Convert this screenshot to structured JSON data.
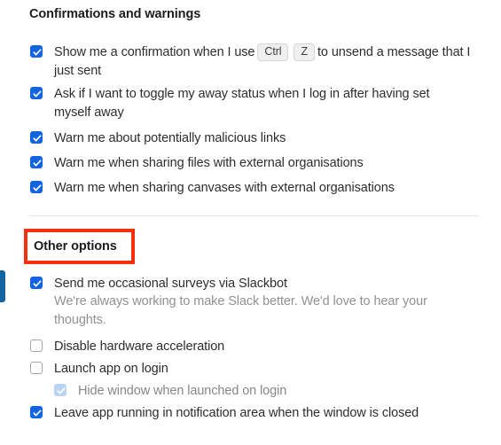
{
  "sections": [
    {
      "id": "confirmations",
      "title": "Confirmations and warnings",
      "options": [
        {
          "id": "unsend-confirmation",
          "checked": true,
          "label_before": "Show me a confirmation when I use",
          "keys": [
            "Ctrl",
            "Z"
          ],
          "label_after": "to unsend a message that I just sent"
        },
        {
          "id": "away-status-toggle",
          "checked": true,
          "label": "Ask if I want to toggle my away status when I log in after having set myself away"
        },
        {
          "id": "malicious-links",
          "checked": true,
          "label": "Warn me about potentially malicious links"
        },
        {
          "id": "sharing-files-external",
          "checked": true,
          "label": "Warn me when sharing files with external organisations"
        },
        {
          "id": "sharing-canvases-external",
          "checked": true,
          "label": "Warn me when sharing canvases with external organisations"
        }
      ]
    },
    {
      "id": "other-options",
      "title": "Other options",
      "highlighted": true,
      "highlight_color": "#f5300c",
      "options": [
        {
          "id": "slackbot-surveys",
          "checked": true,
          "label": "Send me occasional surveys via Slackbot",
          "description": "We're always working to make Slack better. We'd love to hear your thoughts."
        },
        {
          "id": "disable-hardware-acceleration",
          "checked": false,
          "label": "Disable hardware acceleration"
        },
        {
          "id": "launch-app-on-login",
          "checked": false,
          "label": "Launch app on login"
        },
        {
          "id": "hide-window-on-launch",
          "checked": true,
          "disabled": true,
          "label": "Hide window when launched on login"
        },
        {
          "id": "leave-app-running",
          "checked": true,
          "label": "Leave app running in notification area when the window is closed"
        }
      ]
    }
  ],
  "colors": {
    "checkbox_checked": "#1264e0",
    "checkbox_disabled": "#b9d4f5",
    "highlight": "#f5300c",
    "edge_bar": "#1264a3",
    "text": "#2d2d2d",
    "muted_text": "#919191"
  }
}
